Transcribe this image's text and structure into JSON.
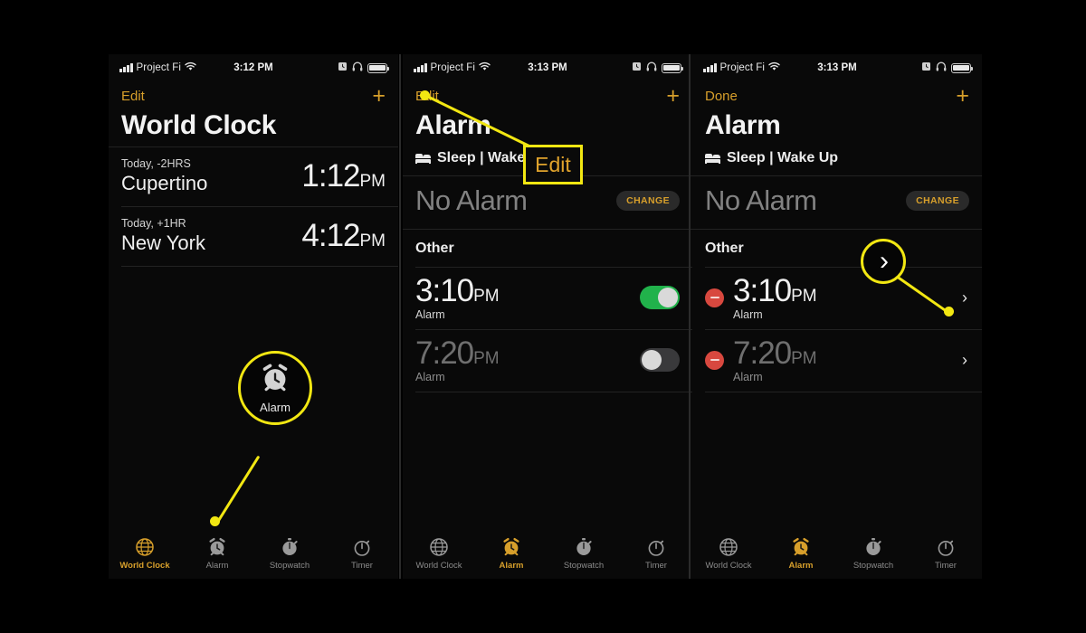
{
  "meta": {
    "background": "#000000",
    "accent_amber": "#d79f2b",
    "callout_yellow": "#f2e712",
    "toggle_on_green": "#21b24b",
    "delete_red": "#d8483f"
  },
  "panels": [
    {
      "id": "world-clock",
      "statusbar": {
        "carrier": "Project Fi",
        "time": "3:12 PM",
        "signal_icon": "signal-bars-icon",
        "wifi_icon": "wifi-icon",
        "alarm_icon": "alarm-clock-status-icon",
        "headphones_icon": "headphones-icon",
        "battery_icon": "battery-icon"
      },
      "nav": {
        "left_action": "Edit",
        "right_action": "+"
      },
      "title": "World Clock",
      "clocks": [
        {
          "offset": "Today, -2HRS",
          "city": "Cupertino",
          "time": "1:12",
          "ampm": "PM"
        },
        {
          "offset": "Today, +1HR",
          "city": "New York",
          "time": "4:12",
          "ampm": "PM"
        }
      ],
      "tabs": [
        {
          "label": "World Clock",
          "icon": "globe-icon",
          "active": true
        },
        {
          "label": "Alarm",
          "icon": "alarm-clock-icon",
          "active": false
        },
        {
          "label": "Stopwatch",
          "icon": "stopwatch-icon",
          "active": false
        },
        {
          "label": "Timer",
          "icon": "timer-icon",
          "active": false
        }
      ]
    },
    {
      "id": "alarm-list",
      "statusbar": {
        "carrier": "Project Fi",
        "time": "3:13 PM",
        "signal_icon": "signal-bars-icon",
        "wifi_icon": "wifi-icon",
        "alarm_icon": "alarm-clock-status-icon",
        "headphones_icon": "headphones-icon",
        "battery_icon": "battery-icon"
      },
      "nav": {
        "left_action": "Edit",
        "right_action": "+"
      },
      "title": "Alarm",
      "sleep_row": {
        "icon": "bed-icon",
        "label": "Sleep | Wake Up",
        "status": "No Alarm",
        "change_label": "CHANGE"
      },
      "section_label": "Other",
      "alarms": [
        {
          "time": "3:10",
          "ampm": "PM",
          "sub": "Alarm",
          "enabled": true
        },
        {
          "time": "7:20",
          "ampm": "PM",
          "sub": "Alarm",
          "enabled": false
        }
      ],
      "tabs": [
        {
          "label": "World Clock",
          "icon": "globe-icon",
          "active": false
        },
        {
          "label": "Alarm",
          "icon": "alarm-clock-icon",
          "active": true
        },
        {
          "label": "Stopwatch",
          "icon": "stopwatch-icon",
          "active": false
        },
        {
          "label": "Timer",
          "icon": "timer-icon",
          "active": false
        }
      ]
    },
    {
      "id": "alarm-edit",
      "statusbar": {
        "carrier": "Project Fi",
        "time": "3:13 PM",
        "signal_icon": "signal-bars-icon",
        "wifi_icon": "wifi-icon",
        "alarm_icon": "alarm-clock-status-icon",
        "headphones_icon": "headphones-icon",
        "battery_icon": "battery-icon"
      },
      "nav": {
        "left_action": "Done",
        "right_action": "+"
      },
      "title": "Alarm",
      "sleep_row": {
        "icon": "bed-icon",
        "label": "Sleep | Wake Up",
        "status": "No Alarm",
        "change_label": "CHANGE"
      },
      "section_label": "Other",
      "alarms": [
        {
          "time": "3:10",
          "ampm": "PM",
          "sub": "Alarm",
          "enabled": true,
          "delete_icon": "minus-circle-icon",
          "chevron": "›"
        },
        {
          "time": "7:20",
          "ampm": "PM",
          "sub": "Alarm",
          "enabled": false,
          "delete_icon": "minus-circle-icon",
          "chevron": "›"
        }
      ],
      "tabs": [
        {
          "label": "World Clock",
          "icon": "globe-icon",
          "active": false
        },
        {
          "label": "Alarm",
          "icon": "alarm-clock-icon",
          "active": true
        },
        {
          "label": "Stopwatch",
          "icon": "stopwatch-icon",
          "active": false
        },
        {
          "label": "Timer",
          "icon": "timer-icon",
          "active": false
        }
      ]
    }
  ],
  "callouts": [
    {
      "id": "alarm-tab-callout",
      "type": "circle",
      "content_icon": "alarm-clock-icon",
      "label": "Alarm"
    },
    {
      "id": "edit-button-callout",
      "type": "box",
      "label": "Edit"
    },
    {
      "id": "chevron-callout",
      "type": "circle",
      "content_icon": "chevron-right-icon",
      "label": "›"
    }
  ]
}
